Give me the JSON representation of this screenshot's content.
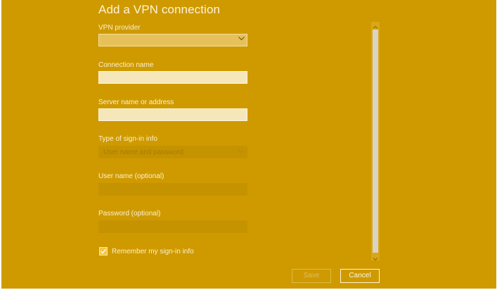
{
  "dialog": {
    "title": "Add a VPN connection"
  },
  "fields": {
    "vpn_provider": {
      "label": "VPN provider",
      "value": ""
    },
    "connection_name": {
      "label": "Connection name",
      "value": ""
    },
    "server": {
      "label": "Server name or address",
      "value": ""
    },
    "signin_type": {
      "label": "Type of sign-in info",
      "value": "User name and password"
    },
    "username": {
      "label": "User name (optional)",
      "value": ""
    },
    "password": {
      "label": "Password (optional)",
      "value": ""
    }
  },
  "remember": {
    "label": "Remember my sign-in info",
    "checked": true
  },
  "buttons": {
    "save": "Save",
    "cancel": "Cancel"
  },
  "colors": {
    "accent": "#cf9a00",
    "input_active": "#f6e7bb",
    "text_light": "#fbf0cf"
  },
  "icons": {
    "dropdown": "chevron-down-icon",
    "scroll_up": "scroll-up-arrow-icon",
    "scroll_down": "scroll-down-arrow-icon",
    "check": "checkmark-icon"
  }
}
